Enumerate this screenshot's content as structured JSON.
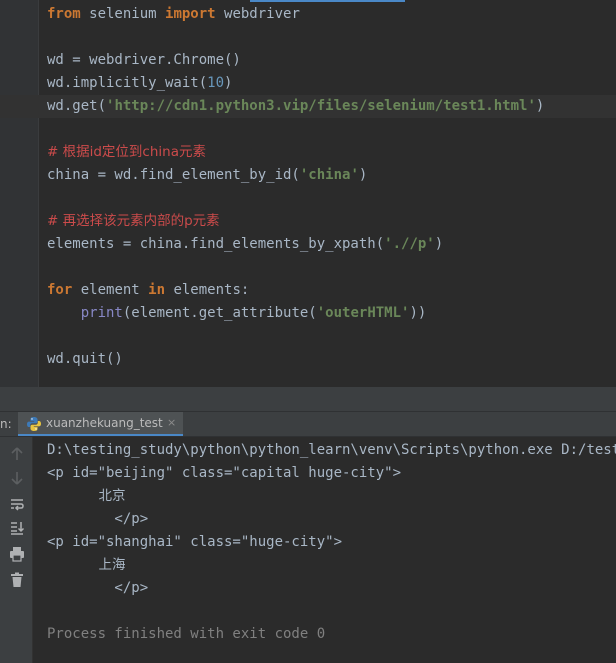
{
  "editor": {
    "lines": [
      [
        {
          "t": "from",
          "c": "kw"
        },
        {
          "t": " selenium ",
          "c": "id"
        },
        {
          "t": "import",
          "c": "kw"
        },
        {
          "t": " webdriver",
          "c": "id"
        }
      ],
      [],
      [
        {
          "t": "wd = webdriver.Chrome()",
          "c": "id"
        }
      ],
      [
        {
          "t": "wd.implicitly_wait(",
          "c": "id"
        },
        {
          "t": "10",
          "c": "num"
        },
        {
          "t": ")",
          "c": "id"
        }
      ],
      [
        {
          "t": "wd.get(",
          "c": "id"
        },
        {
          "t": "'http://cdn1.python3.vip/files/selenium/test1.html'",
          "c": "str"
        },
        {
          "t": ")",
          "c": "id"
        }
      ],
      [],
      [
        {
          "t": "# 根据id定位到china元素",
          "c": "cmt"
        }
      ],
      [
        {
          "t": "china = wd.find_element_by_id(",
          "c": "id"
        },
        {
          "t": "'china'",
          "c": "str"
        },
        {
          "t": ")",
          "c": "id"
        }
      ],
      [],
      [
        {
          "t": "# 再选择该元素内部的p元素",
          "c": "cmt"
        }
      ],
      [
        {
          "t": "elements = china.find_elements_by_xpath(",
          "c": "id"
        },
        {
          "t": "'.//p'",
          "c": "str"
        },
        {
          "t": ")",
          "c": "id"
        }
      ],
      [],
      [
        {
          "t": "for",
          "c": "kw"
        },
        {
          "t": " element ",
          "c": "id"
        },
        {
          "t": "in",
          "c": "kw"
        },
        {
          "t": " elements:",
          "c": "id"
        }
      ],
      [
        {
          "t": "    ",
          "c": "id"
        },
        {
          "t": "print",
          "c": "bi"
        },
        {
          "t": "(element.get_attribute(",
          "c": "id"
        },
        {
          "t": "'outerHTML'",
          "c": "str"
        },
        {
          "t": "))",
          "c": "id"
        }
      ],
      [],
      [
        {
          "t": "wd.quit()",
          "c": "id"
        }
      ]
    ],
    "current_line_index": 4
  },
  "run_window": {
    "label": "n:",
    "tab_name": "xuanzhekuang_test",
    "tab_close": "×"
  },
  "toolbar": {
    "buttons": [
      {
        "name": "up-arrow-icon",
        "enabled": false
      },
      {
        "name": "down-arrow-icon",
        "enabled": false
      },
      {
        "name": "soft-wrap-icon",
        "enabled": true
      },
      {
        "name": "scroll-to-end-icon",
        "enabled": true
      },
      {
        "name": "print-icon",
        "enabled": true
      },
      {
        "name": "trash-icon",
        "enabled": true
      }
    ]
  },
  "console": {
    "lines": [
      {
        "text": "D:\\testing_study\\python\\python_learn\\venv\\Scripts\\python.exe D:/testing",
        "style": "mono"
      },
      {
        "text": "<p id=\"beijing\" class=\"capital huge-city\">",
        "style": "mono"
      },
      {
        "text": "            北京",
        "style": "zh"
      },
      {
        "text": "        </p>",
        "style": "mono"
      },
      {
        "text": "<p id=\"shanghai\" class=\"huge-city\">",
        "style": "mono"
      },
      {
        "text": "            上海",
        "style": "zh"
      },
      {
        "text": "        </p>",
        "style": "mono"
      },
      {
        "text": "",
        "style": "mono"
      },
      {
        "text": "Process finished with exit code 0",
        "style": "gray"
      }
    ]
  }
}
